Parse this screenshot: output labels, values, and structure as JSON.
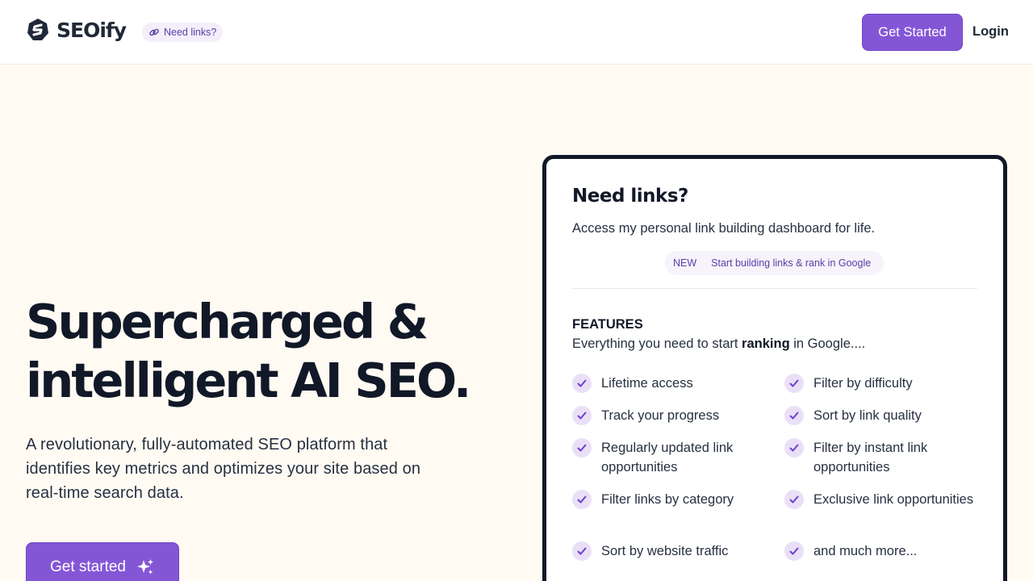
{
  "header": {
    "logo_text": "SEOify",
    "pill_label": "Need links?",
    "cta_label": "Get Started",
    "login_label": "Login"
  },
  "hero": {
    "title_line1": "Supercharged &",
    "title_line2": "intelligent AI SEO.",
    "description": "A revolutionary, fully-automated SEO platform that identifies key metrics and optimizes your site based on real-time search data.",
    "cta_label": "Get started"
  },
  "card": {
    "title": "Need links?",
    "subtitle": "Access my personal link building dashboard for life.",
    "new_tag": "NEW",
    "new_text": "Start building links & rank in Google",
    "features_heading": "FEATURES",
    "features_sub_before": "Everything you need to start ",
    "features_sub_bold": "ranking",
    "features_sub_after": " in Google....",
    "features": [
      "Lifetime access",
      "Filter by difficulty",
      "Track your progress",
      "Sort by link quality",
      "Regularly updated link opportunities",
      "Filter by instant link opportunities",
      "Filter links by category",
      "Exclusive link opportunities",
      "Sort by website traffic",
      "and much more..."
    ]
  },
  "colors": {
    "accent": "#8456d6",
    "page_bg": "#fffbf3",
    "check_bg": "#e9e0f8"
  },
  "icons": {
    "logo": "seoify-logo-icon",
    "pill": "link-icon",
    "hero_button": "sparkles-icon",
    "feature": "check-icon"
  }
}
